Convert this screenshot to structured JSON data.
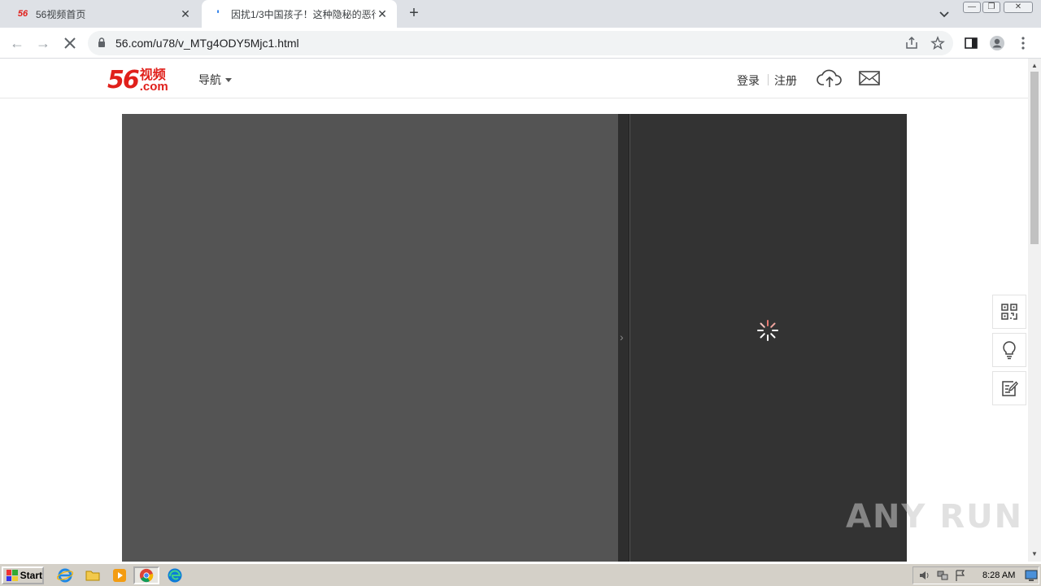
{
  "browser": {
    "tabs": [
      {
        "favicon_text": "56",
        "title": "56视频首页",
        "active": false
      },
      {
        "favicon_text": "'",
        "title": "因扰1/3中国孩子！这种隐秘的恶行...",
        "active": true
      }
    ],
    "new_tab_label": "+",
    "url": "56.com/u78/v_MTg4ODY5Mjc1.html",
    "window_controls": [
      "minimize",
      "restore",
      "close"
    ]
  },
  "site": {
    "logo_number": "56",
    "logo_cn": "视频",
    "logo_com": ".com",
    "nav_label": "导航",
    "login_label": "登录",
    "register_label": "注册"
  },
  "watermark": "ANY RUN",
  "taskbar": {
    "start_label": "Start",
    "clock": "8:28 AM"
  }
}
